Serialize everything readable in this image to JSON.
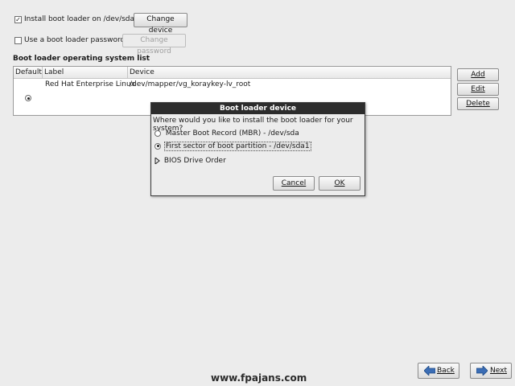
{
  "options": {
    "install_checkbox_checked": true,
    "install_label": "Install boot loader on /dev/sda.",
    "change_device_label": "Change device",
    "password_checkbox_checked": false,
    "password_label": "Use a boot loader password",
    "change_password_label": "Change password"
  },
  "os_list": {
    "heading": "Boot loader operating system list",
    "columns": [
      "Default",
      "Label",
      "Device"
    ],
    "rows": [
      {
        "default": true,
        "label": "Red Hat Enterprise Linux",
        "device": "/dev/mapper/vg_koraykey-lv_root"
      }
    ],
    "buttons": {
      "add": "Add",
      "edit": "Edit",
      "delete": "Delete"
    }
  },
  "dialog": {
    "title": "Boot loader device",
    "question": "Where would you like to install the boot loader for your system?",
    "options": [
      {
        "label": "Master Boot Record (MBR) - /dev/sda",
        "selected": false
      },
      {
        "label": "First sector of boot partition - /dev/sda1",
        "selected": true
      }
    ],
    "bios_label": "BIOS Drive Order",
    "cancel_label": "Cancel",
    "ok_label": "OK"
  },
  "watermark": "www.fpajans.com",
  "nav": {
    "back_label": "Back",
    "next_label": "Next"
  }
}
